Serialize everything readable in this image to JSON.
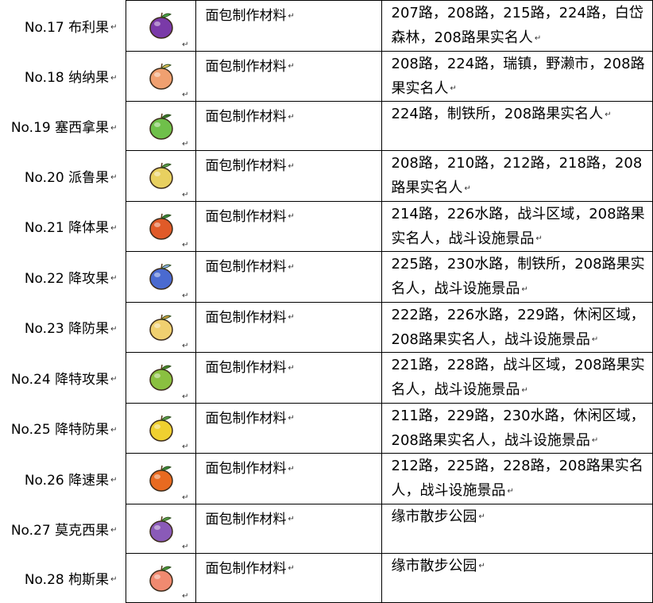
{
  "return_mark": "↵",
  "rows": [
    {
      "name": "No.17 布利果",
      "use": "面包制作材料",
      "loc": "207路，208路，215路，224路，白岱森林，208路果实名人",
      "icon": "grape-berry-icon",
      "color": "#7a3aa8",
      "accent": "#4aa84a"
    },
    {
      "name": "No.18 纳纳果",
      "use": "面包制作材料",
      "loc": "208路，224路，瑞镇，野濑市，208路果实名人",
      "icon": "banana-berry-icon",
      "color": "#f0a070",
      "accent": "#e6c45a"
    },
    {
      "name": "No.19 塞西拿果",
      "use": "面包制作材料",
      "loc": "224路，制铁所，208路果实名人",
      "icon": "pear-berry-icon",
      "color": "#6fc04a",
      "accent": "#3a7a2a"
    },
    {
      "name": "No.20 派鲁果",
      "use": "面包制作材料",
      "loc": "208路，210路，212路，218路，208路果实名人",
      "icon": "pineapple-berry-icon",
      "color": "#e8d060",
      "accent": "#5aa04a"
    },
    {
      "name": "No.21 降体果",
      "use": "面包制作材料",
      "loc": "214路，226水路，战斗区域，208路果实名人，战斗设施景品",
      "icon": "orange-berry-icon",
      "color": "#e05a28",
      "accent": "#3a8a3a"
    },
    {
      "name": "No.22 降攻果",
      "use": "面包制作材料",
      "loc": "225路，230水路，制铁所，208路果实名人，战斗设施景品",
      "icon": "skewer-berry-icon",
      "color": "#4a6ad0",
      "accent": "#90b0f0"
    },
    {
      "name": "No.23 降防果",
      "use": "面包制作材料",
      "loc": "222路，226水路，229路，休闲区域，208路果实名人，战斗设施景品",
      "icon": "yellow-berry-icon",
      "color": "#f0d070",
      "accent": "#d0a040"
    },
    {
      "name": "No.24 降特攻果",
      "use": "面包制作材料",
      "loc": "221路，228路，战斗区域，208路果实名人，战斗设施景品",
      "icon": "melon-berry-icon",
      "color": "#8ac040",
      "accent": "#4a8a2a"
    },
    {
      "name": "No.25 降特防果",
      "use": "面包制作材料",
      "loc": "211路，229路，230水路，休闲区域，208路果实名人，战斗设施景品",
      "icon": "lemon-berry-icon",
      "color": "#f0d030",
      "accent": "#5aa04a"
    },
    {
      "name": "No.26 降速果",
      "use": "面包制作材料",
      "loc": "212路，225路，228路，208路果实名人，战斗设施景品",
      "icon": "spiky-berry-icon",
      "color": "#e86a20",
      "accent": "#3a8a3a"
    },
    {
      "name": "No.27 莫克西果",
      "use": "面包制作材料",
      "loc": "缘市散步公园",
      "icon": "grape-leaf-berry-icon",
      "color": "#8a5ab8",
      "accent": "#5aa04a"
    },
    {
      "name": "No.28 枸斯果",
      "use": "面包制作材料",
      "loc": "缘市散步公园",
      "icon": "peach-berry-icon",
      "color": "#f08a70",
      "accent": "#4a9a3a"
    }
  ]
}
